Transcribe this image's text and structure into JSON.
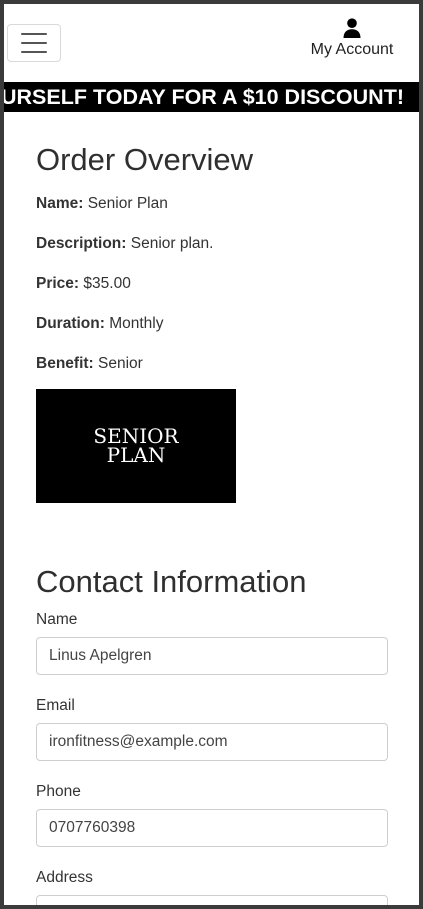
{
  "nav": {
    "account_label": "My Account",
    "menu_icon": "hamburger-icon",
    "account_icon": "user-icon"
  },
  "banner": {
    "text": "URSELF TODAY FOR A $10 DISCOUNT!"
  },
  "order": {
    "title": "Order Overview",
    "details": [
      {
        "label": "Name:",
        "value": "Senior Plan"
      },
      {
        "label": "Description:",
        "value": "Senior plan."
      },
      {
        "label": "Price:",
        "value": "$35.00"
      },
      {
        "label": "Duration:",
        "value": "Monthly"
      },
      {
        "label": "Benefit:",
        "value": "Senior"
      }
    ],
    "image_line1": "SENIOR",
    "image_line2": "PLAN"
  },
  "contact": {
    "title": "Contact Information",
    "fields": [
      {
        "label": "Name",
        "value": "Linus Apelgren"
      },
      {
        "label": "Email",
        "value": "ironfitness@example.com"
      },
      {
        "label": "Phone",
        "value": "0707760398"
      },
      {
        "label": "Address",
        "value": ""
      }
    ]
  },
  "colors": {
    "banner_bg": "#000000",
    "page_bg": "#ffffff",
    "outer_bg": "#3b3b3b"
  }
}
